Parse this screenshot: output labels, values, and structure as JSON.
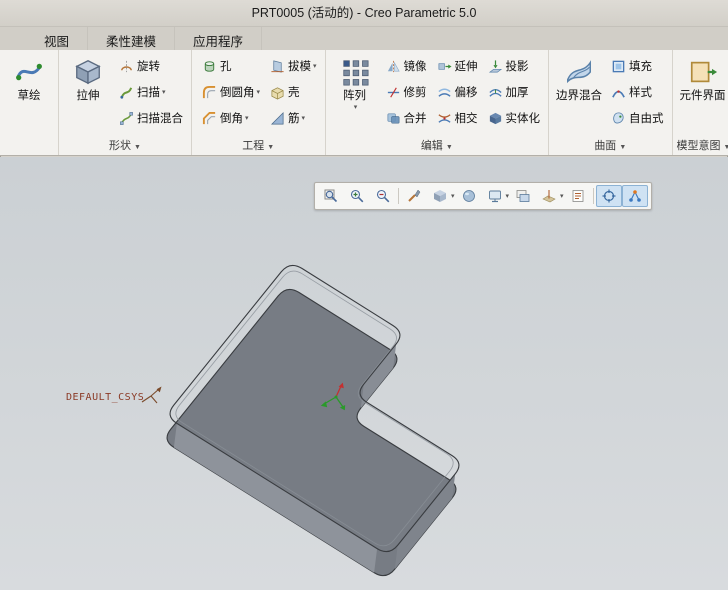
{
  "window": {
    "title": "PRT0005 (活动的) - Creo Parametric 5.0"
  },
  "tabs": {
    "view": "视图",
    "flex": "柔性建模",
    "apps": "应用程序"
  },
  "ui": {
    "caret": "▼",
    "caret_small": "▾"
  },
  "ribbon": {
    "sketch": "草绘",
    "shapes": {
      "extrude": "拉伸",
      "revolve": "旋转",
      "sweep": "扫描",
      "sweep_blend": "扫描混合",
      "footer": "形状"
    },
    "engineering": {
      "hole": "孔",
      "round": "倒圆角",
      "chamfer": "倒角",
      "draft": "拔模",
      "shell": "壳",
      "rib": "筋",
      "footer": "工程"
    },
    "editing": {
      "pattern": "阵列",
      "mirror": "镜像",
      "trim": "修剪",
      "merge": "合并",
      "extend": "延伸",
      "offset": "偏移",
      "intersect": "相交",
      "project": "投影",
      "thicken": "加厚",
      "solidify": "实体化",
      "footer": "编辑"
    },
    "surfaces": {
      "boundary_blend": "边界混合",
      "fill": "填充",
      "style": "样式",
      "freestyle": "自由式",
      "footer": "曲面"
    },
    "intent": {
      "component_interface": "元件界面",
      "footer": "模型意图"
    }
  },
  "graphics_toolbar": {
    "icons": [
      "refit",
      "zoom-in",
      "zoom-out",
      "repaint",
      "display-style",
      "shaded-view",
      "saved-orientations",
      "view-manager",
      "datum-display",
      "annotation-display",
      "spin-center",
      "view-graph"
    ]
  },
  "graphics": {
    "csys_label": "DEFAULT_CSYS"
  },
  "colors": {
    "ribbon_bg": "#f3f2ef",
    "titlebar_bg": "#d9d6cf",
    "viewport_top": "#cbd0d4",
    "viewport_bottom": "#d8dbde",
    "part_top": "#a9aeb5",
    "part_side": "#84898f",
    "edge": "#393c40",
    "csys_label_color": "#8b3a26",
    "accent_blue": "#4a7ab5"
  }
}
